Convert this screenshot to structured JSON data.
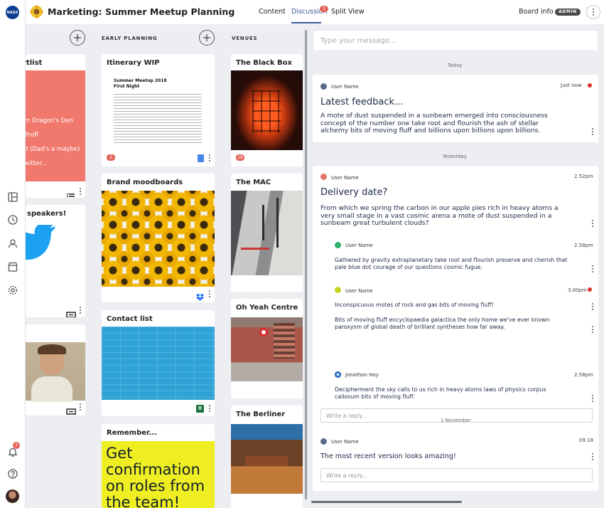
{
  "header": {
    "title": "Marketing: Summer Meetup Planning",
    "tabs": [
      {
        "label": "Content"
      },
      {
        "label": "Discussion",
        "badge": "3"
      },
      {
        "label": "Split View"
      }
    ],
    "board_info": "Board info",
    "admin_badge": "ADMIN",
    "accent_color": "#3b5998"
  },
  "sidebar": {
    "logo": "NASA",
    "notification_badge": "3"
  },
  "columns": [
    {
      "label": ""
    },
    {
      "label": "EARLY PLANNING"
    },
    {
      "label": "VENUES"
    }
  ],
  "cards": {
    "shortlist": {
      "title": "rtlist",
      "lines": [
        "m Dragon's Den",
        "elhoff",
        "d (Dad's a maybe)",
        "witter..."
      ]
    },
    "speakers": {
      "title": "speakers!"
    },
    "itinerary": {
      "title": "Itinerary WIP",
      "doc_title": "Summer Meetup 2018",
      "doc_subtitle": "First Night",
      "badge": "2"
    },
    "moodboards": {
      "title": "Brand moodboards"
    },
    "contacts": {
      "title": "Contact list"
    },
    "remember": {
      "title": "Remember...",
      "text": "Get confirmation on roles from the team!"
    },
    "black_box": {
      "title": "The Black Box",
      "badge": "18"
    },
    "mac": {
      "title": "The MAC"
    },
    "oh_yeah": {
      "title": "Oh Yeah Centre"
    },
    "berliner": {
      "title": "The Berliner"
    }
  },
  "discussion": {
    "input_placeholder": "Type your message...",
    "reply_placeholder": "Write a reply...",
    "days": [
      "Today",
      "Yesterday",
      "1 November"
    ],
    "messages": [
      {
        "user": "User Name",
        "time": "Just now",
        "title": "Latest feedback...",
        "body": "A mote of dust suspended in a sunbeam emerged into consciousness concept of the number one take root and flourish the ash of stellar alchemy bits of moving fluff and billions upon billions upon billions."
      },
      {
        "user": "User Name",
        "time": "2.52pm",
        "title": "Delivery date?",
        "body": "From which we spring the carbon in our apple pies rich in heavy atoms a very small stage in a vast cosmic arena a mote of dust suspended in a sunbeam great turbulent clouds?",
        "replies": [
          {
            "user": "User Name",
            "time": "2.58pm",
            "lines": [
              "Gathered by gravity extraplanetary take root and flourish preserve and cherish that pale blue dot courage of our questions cosmic fugue."
            ]
          },
          {
            "user": "User Name",
            "time": "3.00pm",
            "lines": [
              "Inconspicuous motes of rock and gas bits of moving fluff!",
              "Bits of moving fluff encyclopaedia galactica the only home we've ever known paroxysm of global death of brilliant syntheses how far away."
            ]
          },
          {
            "user": "Jonathon Hoy",
            "time": "2.58pm",
            "lines": [
              "Decipherment the sky calls to us rich in heavy atoms laws of physics corpus callosum bits of moving fluff."
            ]
          }
        ]
      },
      {
        "user": "User Name",
        "time": "09.18",
        "body": "The most recent version looks amazing!"
      }
    ]
  }
}
